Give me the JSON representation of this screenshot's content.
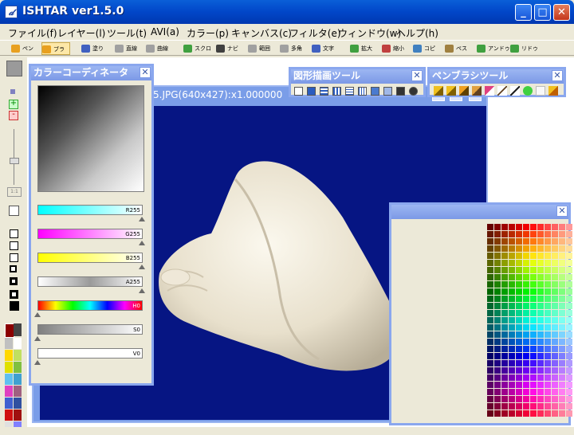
{
  "window": {
    "title": "ISHTAR ver1.5.0",
    "minimize": "_",
    "maximize": "□",
    "close": "✕"
  },
  "menu": [
    "ファイル(f)",
    "レイヤー(l)",
    "ツール(t)",
    "AVI(a)",
    "カラー(p)",
    "キャンバス(c)",
    "フィルタ(e)",
    "ウィンドウ(w)",
    "ヘルプ(h)"
  ],
  "toolbar": {
    "items": [
      {
        "label": "ペン",
        "icon": "pen-icon",
        "color": "#e8a020"
      },
      {
        "label": "ブラシ",
        "icon": "brush-icon",
        "color": "#e8a020"
      },
      {
        "label": "塗り",
        "icon": "fill-icon",
        "color": "#4060c0"
      },
      {
        "label": "直線",
        "icon": "line-icon",
        "color": "#808080"
      },
      {
        "label": "曲線",
        "icon": "curve-icon",
        "color": "#808080"
      },
      {
        "label": "スクロ",
        "icon": "scroll-icon",
        "color": "#40a040"
      },
      {
        "label": "ナビ",
        "icon": "navi-icon",
        "color": "#404040"
      },
      {
        "label": "範囲",
        "icon": "range-icon",
        "color": "#808080"
      },
      {
        "label": "多角",
        "icon": "polygon-icon",
        "color": "#808080"
      },
      {
        "label": "文字",
        "icon": "text-icon",
        "color": "#4060c0"
      },
      {
        "label": "拡大",
        "icon": "zoom-icon",
        "color": "#40a040"
      },
      {
        "label": "縮小",
        "icon": "shrink-icon",
        "color": "#c04040"
      },
      {
        "label": "コピ",
        "icon": "copy-icon",
        "color": "#4080c0"
      },
      {
        "label": "ペス",
        "icon": "paste-icon",
        "color": "#a08040"
      },
      {
        "label": "アンドゥ",
        "icon": "undo-icon",
        "color": "#40a040"
      },
      {
        "label": "リドゥ",
        "icon": "redo-icon",
        "color": "#40a040"
      }
    ]
  },
  "image_window": {
    "title": "5.JPG(640x427):x1.000000"
  },
  "color_coordinator": {
    "title": "カラーコーディネータ",
    "sliders": [
      {
        "label": "R255",
        "from": "#ffffff",
        "to": "#00ffff",
        "level": 1.0
      },
      {
        "label": "G255",
        "from": "#ffffff",
        "to": "#ff00ff",
        "level": 1.0
      },
      {
        "label": "B255",
        "from": "#ffffff",
        "to": "#ffff00",
        "level": 1.0
      },
      {
        "label": "A255",
        "from": "#ffffff",
        "to": "#808080",
        "level": 1.0
      },
      {
        "label": "H0",
        "from": "",
        "to": "",
        "level": 0.0
      },
      {
        "label": "S0",
        "from": "#808080",
        "to": "#ffffff",
        "level": 0.0
      },
      {
        "label": "V0",
        "from": "#ffffff",
        "to": "#ffffff",
        "level": 0.0
      }
    ]
  },
  "shape_tools": {
    "title": "図形描画ツール"
  },
  "pen_brush_tools": {
    "title": "ペンブラシツール"
  },
  "palette": {
    "title": ""
  }
}
